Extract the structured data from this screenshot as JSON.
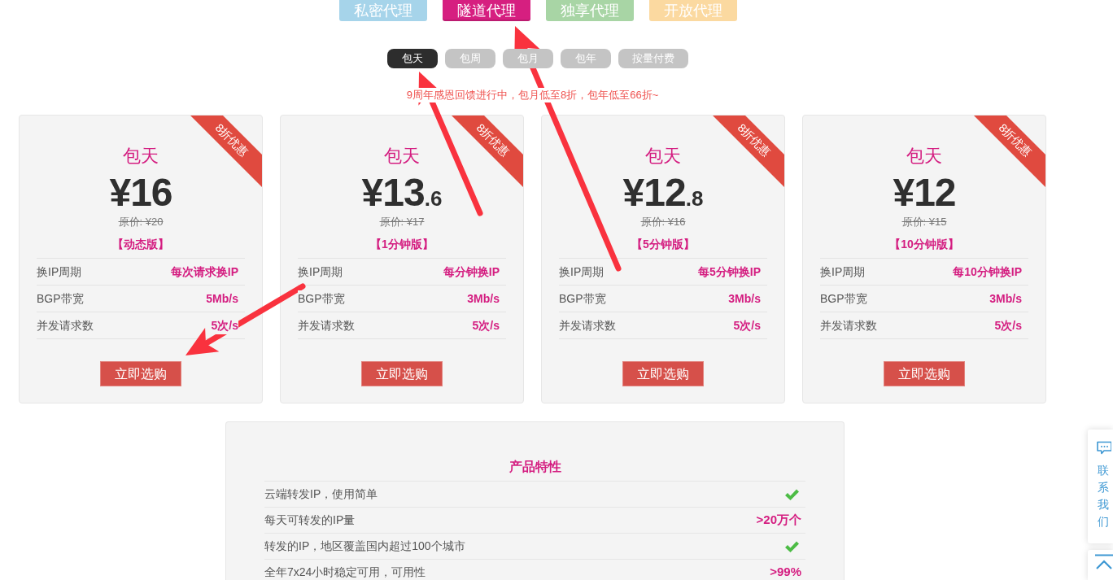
{
  "product_tabs": [
    {
      "label": "私密代理",
      "color": "#a6d4ea",
      "selected": false
    },
    {
      "label": "隧道代理",
      "color": "#d61f80",
      "selected": true
    },
    {
      "label": "独享代理",
      "color": "#a8d5a5",
      "selected": false
    },
    {
      "label": "开放代理",
      "color": "#fbd9a0",
      "selected": false
    }
  ],
  "billing_tabs": [
    {
      "label": "包天",
      "selected": true
    },
    {
      "label": "包周",
      "selected": false
    },
    {
      "label": "包月",
      "selected": false
    },
    {
      "label": "包年",
      "selected": false
    },
    {
      "label": "按量付费",
      "selected": false
    }
  ],
  "promo": "9周年感恩回馈进行中，包月低至8折，包年低至66折~",
  "plans": [
    {
      "ribbon": "8折优惠",
      "title": "包天",
      "price": "¥16",
      "original_price": "原价: ¥20",
      "edition": "【动态版】",
      "specs": [
        {
          "label": "换IP周期",
          "value": "每次请求换IP"
        },
        {
          "label": "BGP带宽",
          "value": "5Mb/s"
        },
        {
          "label": "并发请求数",
          "value": "5次/s"
        }
      ],
      "button": "立即选购"
    },
    {
      "ribbon": "8折优惠",
      "title": "包天",
      "price": "¥13",
      "price_fraction": ".6",
      "original_price": "原价: ¥17",
      "edition": "【1分钟版】",
      "specs": [
        {
          "label": "换IP周期",
          "value": "每分钟换IP"
        },
        {
          "label": "BGP带宽",
          "value": "3Mb/s"
        },
        {
          "label": "并发请求数",
          "value": "5次/s"
        }
      ],
      "button": "立即选购"
    },
    {
      "ribbon": "8折优惠",
      "title": "包天",
      "price": "¥12",
      "price_fraction": ".8",
      "original_price": "原价: ¥16",
      "edition": "【5分钟版】",
      "specs": [
        {
          "label": "换IP周期",
          "value": "每5分钟换IP"
        },
        {
          "label": "BGP带宽",
          "value": "3Mb/s"
        },
        {
          "label": "并发请求数",
          "value": "5次/s"
        }
      ],
      "button": "立即选购"
    },
    {
      "ribbon": "8折优惠",
      "title": "包天",
      "price": "¥12",
      "original_price": "原价: ¥15",
      "edition": "【10分钟版】",
      "specs": [
        {
          "label": "换IP周期",
          "value": "每10分钟换IP"
        },
        {
          "label": "BGP带宽",
          "value": "3Mb/s"
        },
        {
          "label": "并发请求数",
          "value": "5次/s"
        }
      ],
      "button": "立即选购"
    }
  ],
  "features": {
    "title": "产品特性",
    "rows": [
      {
        "label": "云端转发IP，使用简单",
        "kind": "check"
      },
      {
        "label": "每天可转发的IP量",
        "kind": "text",
        "value": ">20万个"
      },
      {
        "label": "转发的IP，地区覆盖国内超过100个城市",
        "kind": "check"
      },
      {
        "label": "全年7x24小时稳定可用，可用性",
        "kind": "text",
        "value": ">99%"
      }
    ]
  },
  "contact_widget": {
    "label": "联系我们"
  }
}
